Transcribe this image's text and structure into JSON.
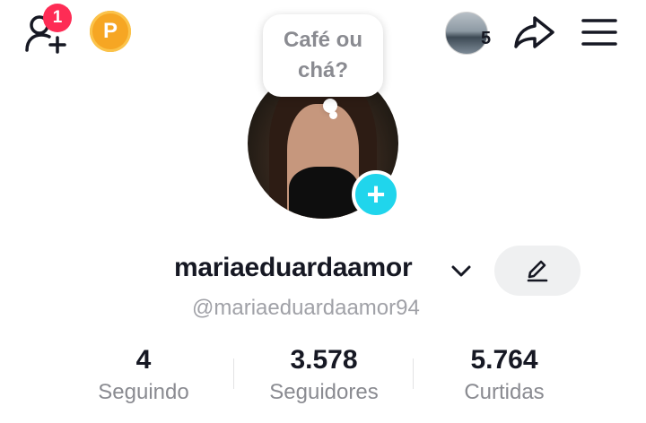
{
  "topbar": {
    "notification_count": "1",
    "coin_letter": "P",
    "story_count": "5"
  },
  "note": {
    "text": "Café ou\nchá?"
  },
  "profile": {
    "display_name": "mariaeduardaamor",
    "handle": "@mariaeduardaamor94"
  },
  "stats": [
    {
      "value": "4",
      "label": "Seguindo"
    },
    {
      "value": "3.578",
      "label": "Seguidores"
    },
    {
      "value": "5.764",
      "label": "Curtidas"
    }
  ],
  "colors": {
    "badge": "#fe2c55",
    "add_photo": "#20d5ec",
    "coin": "#f6a623"
  }
}
